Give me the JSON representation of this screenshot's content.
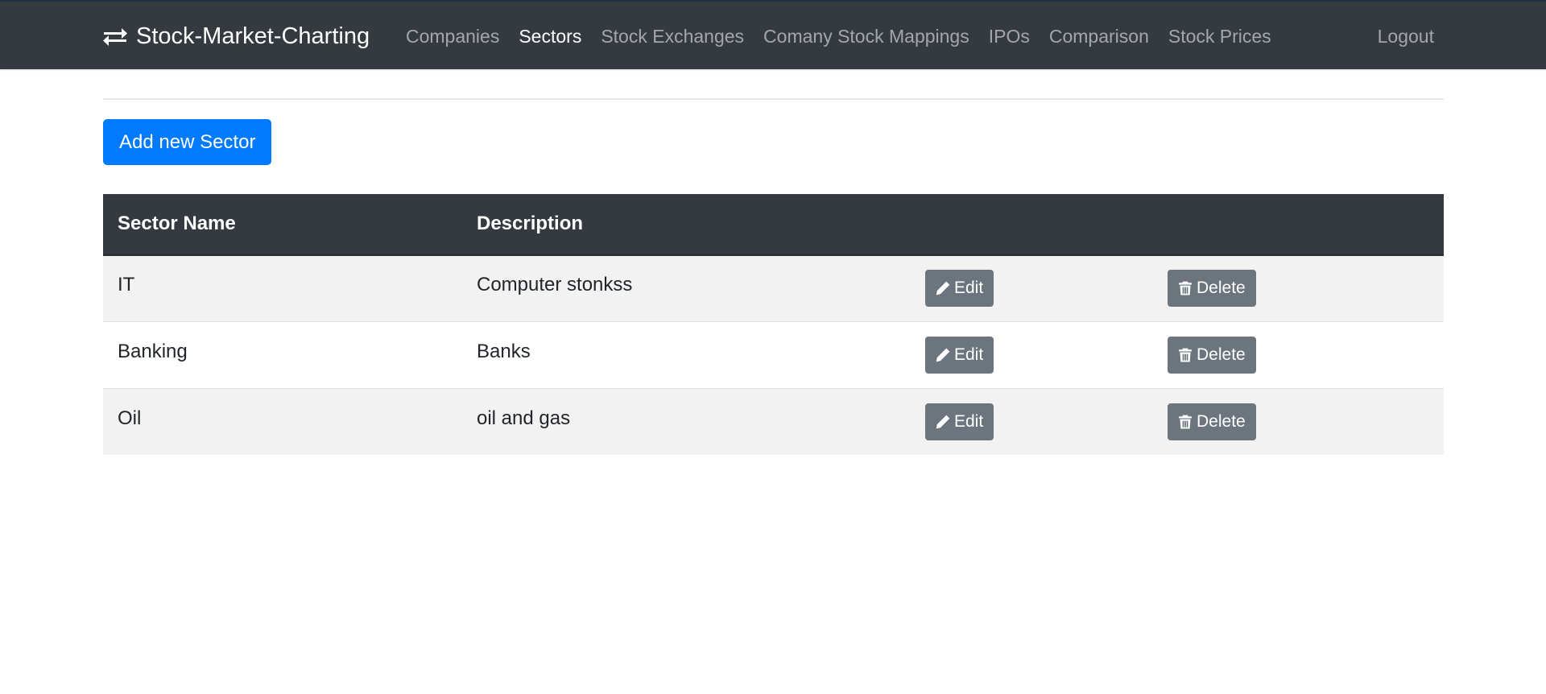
{
  "navbar": {
    "brand": "Stock-Market-Charting",
    "brand_icon": "exchange-arrows-icon",
    "links": [
      {
        "label": "Companies",
        "active": false
      },
      {
        "label": "Sectors",
        "active": true
      },
      {
        "label": "Stock Exchanges",
        "active": false
      },
      {
        "label": "Comany Stock Mappings",
        "active": false
      },
      {
        "label": "IPOs",
        "active": false
      },
      {
        "label": "Comparison",
        "active": false
      },
      {
        "label": "Stock Prices",
        "active": false
      }
    ],
    "logout": "Logout"
  },
  "actions": {
    "add_label": "Add new Sector"
  },
  "table": {
    "headers": [
      "Sector Name",
      "Description",
      "",
      ""
    ],
    "edit_label": "Edit",
    "edit_icon": "pencil-icon",
    "delete_label": "Delete",
    "delete_icon": "trash-icon",
    "rows": [
      {
        "name": "IT",
        "description": "Computer stonkss"
      },
      {
        "name": "Banking",
        "description": "Banks"
      },
      {
        "name": "Oil",
        "description": "oil and gas"
      }
    ]
  },
  "colors": {
    "navbar_bg": "#343a40",
    "primary": "#007bff",
    "secondary": "#6c757d",
    "row_stripe": "#f2f2f2"
  }
}
